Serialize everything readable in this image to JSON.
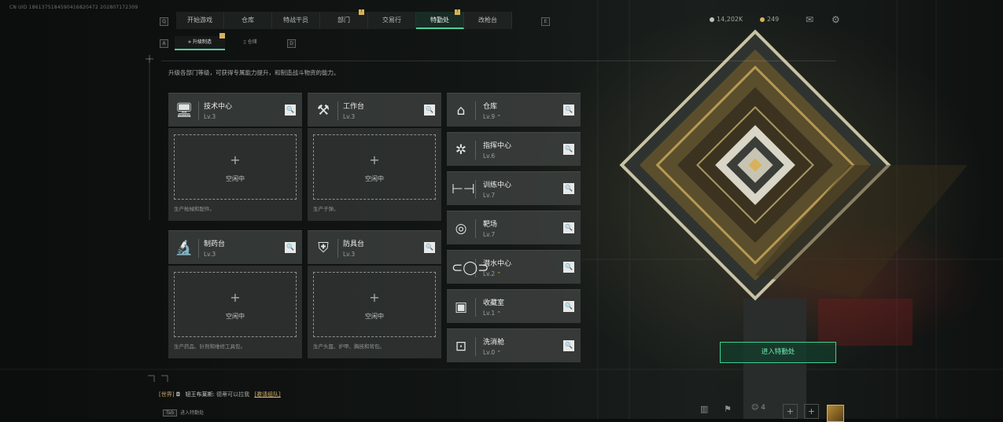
{
  "uid": "CN UID 1861375184590416820472 202807172309",
  "nav": {
    "prev_key": "Q",
    "next_key": "E",
    "tabs": [
      {
        "label": "开始游戏",
        "active": false,
        "badge": false
      },
      {
        "label": "仓库",
        "active": false,
        "badge": false
      },
      {
        "label": "特战干员",
        "active": false,
        "badge": false
      },
      {
        "label": "部门",
        "active": false,
        "badge": true
      },
      {
        "label": "交易行",
        "active": false,
        "badge": false
      },
      {
        "label": "特勤处",
        "active": true,
        "badge": true
      },
      {
        "label": "改枪台",
        "active": false,
        "badge": false
      }
    ]
  },
  "currency": {
    "coins": "14,202K",
    "tickets": "249"
  },
  "subtabs": {
    "prev_key": "A",
    "next_key": "D",
    "items": [
      {
        "label": "升级制造",
        "active": true
      },
      {
        "label": "仓储",
        "active": false
      }
    ]
  },
  "description": "升级各部门等级，可获得专属能力提升，和制造战斗物资的能力。",
  "workshops": [
    {
      "name": "技术中心",
      "level": "Lv.3",
      "icon": "computer-icon",
      "idle": "空闲中",
      "produce": "生产枪械和配件。"
    },
    {
      "name": "工作台",
      "level": "Lv.3",
      "icon": "tools-icon",
      "idle": "空闲中",
      "produce": "生产子弹。"
    },
    {
      "name": "制药台",
      "level": "Lv.3",
      "icon": "microscope-icon",
      "idle": "空闲中",
      "produce": "生产药品、针剂和维修工具包。"
    },
    {
      "name": "防具台",
      "level": "Lv.3",
      "icon": "armor-icon",
      "idle": "空闲中",
      "produce": "生产头盔、护甲、胸挂和背包。"
    }
  ],
  "facilities": [
    {
      "name": "仓库",
      "level": "Lv.9",
      "icon": "warehouse-icon",
      "upgrade": true
    },
    {
      "name": "指挥中心",
      "level": "Lv.6",
      "icon": "command-chip-icon",
      "upgrade": false
    },
    {
      "name": "训练中心",
      "level": "Lv.7",
      "icon": "dumbbell-icon",
      "upgrade": false
    },
    {
      "name": "靶场",
      "level": "Lv.7",
      "icon": "target-icon",
      "upgrade": false
    },
    {
      "name": "潜水中心",
      "level": "Lv.2",
      "icon": "diving-mask-icon",
      "upgrade": true
    },
    {
      "name": "收藏室",
      "level": "Lv.1",
      "icon": "collection-icon",
      "upgrade": true
    },
    {
      "name": "洗消舱",
      "level": "Lv.0",
      "icon": "decontamination-icon",
      "upgrade": true
    }
  ],
  "enter_button": "进入特勤处",
  "chat": {
    "channel": "[世界]",
    "nick": "钮王布莱斯:",
    "message": "德蒂可以拉我",
    "link": "[邀请组队]"
  },
  "tab_hint": {
    "key": "Tab",
    "label": "进入特勤处"
  },
  "bottom": {
    "friends_count": "4"
  }
}
